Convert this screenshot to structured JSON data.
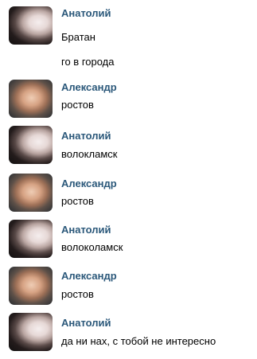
{
  "messages": [
    {
      "author": "Анатолий",
      "avatar": "dark-avatar",
      "lines": [
        "Братан",
        "го в города"
      ]
    },
    {
      "author": "Александр",
      "avatar": "face-avatar",
      "lines": [
        "ростов"
      ]
    },
    {
      "author": "Анатолий",
      "avatar": "dark-avatar",
      "lines": [
        "волокламск"
      ]
    },
    {
      "author": "Александр",
      "avatar": "face-avatar",
      "lines": [
        "ростов"
      ]
    },
    {
      "author": "Анатолий",
      "avatar": "dark-avatar",
      "lines": [
        "волоколамск"
      ]
    },
    {
      "author": "Александр",
      "avatar": "face-avatar",
      "lines": [
        "ростов"
      ]
    },
    {
      "author": "Анатолий",
      "avatar": "dark-avatar",
      "lines": [
        "да ни нах, с тобой не интересно"
      ]
    }
  ]
}
